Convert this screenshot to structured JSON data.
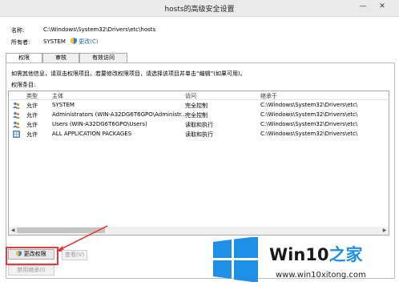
{
  "window": {
    "title": "hosts的高级安全设置",
    "minimize_glyph": "—",
    "close_glyph": "✕"
  },
  "info": {
    "name_label": "名称:",
    "name_value": "C:\\Windows\\System32\\Drivers\\etc\\hosts",
    "owner_label": "所有者:",
    "owner_value": "SYSTEM",
    "change_owner_link": "更改(C)"
  },
  "tabs": [
    {
      "label": "权限"
    },
    {
      "label": "审核"
    },
    {
      "label": "有效访问"
    }
  ],
  "permissions": {
    "hint": "如需其他信息，请双击权限项目。若要修改权限项目，请选择该项目并单击“编辑”(如果可用)。",
    "entries_label": "权限条目:",
    "columns": [
      "类型",
      "主体",
      "访问",
      "继承于"
    ],
    "rows": [
      {
        "type": "允许",
        "principal": "SYSTEM",
        "access": "完全控制",
        "inherited_from": "C:\\Windows\\System32\\Drivers\\etc\\",
        "icon": "user-group-icon"
      },
      {
        "type": "允许",
        "principal": "Administrators (WIN-A32DG6T6GPO\\Administr...",
        "access": "完全控制",
        "inherited_from": "C:\\Windows\\System32\\Drivers\\etc\\",
        "icon": "user-group-icon"
      },
      {
        "type": "允许",
        "principal": "Users (WIN-A32DG6T6GPO\\Users)",
        "access": "读取和执行",
        "inherited_from": "C:\\Windows\\System32\\Drivers\\etc\\",
        "icon": "user-group-icon"
      },
      {
        "type": "允许",
        "principal": "ALL APPLICATION PACKAGES",
        "access": "读取和执行",
        "inherited_from": "C:\\Windows\\System32\\Drivers\\etc\\",
        "icon": "app-package-icon"
      }
    ]
  },
  "buttons": {
    "change_permissions": "更改权限",
    "view": "查看(V)",
    "disable_inheritance": "禁用继承(I)"
  },
  "watermark": {
    "brand": "Win10",
    "brand_suffix": "之家",
    "url": "www.win10xitong.com"
  },
  "colors": {
    "highlight": "#e53a3a",
    "win_blue": "#1e90e8"
  }
}
